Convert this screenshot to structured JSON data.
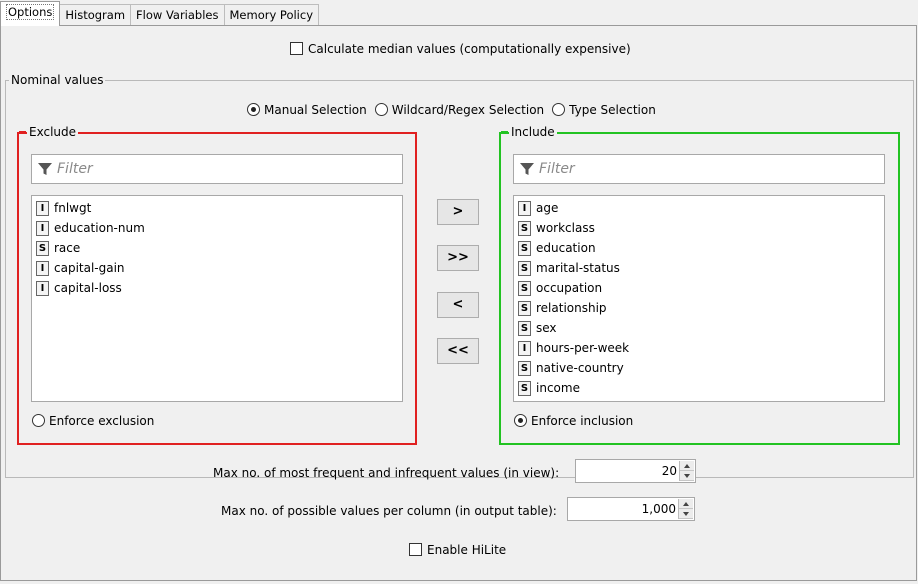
{
  "tabs": [
    "Options",
    "Histogram",
    "Flow Variables",
    "Memory Policy"
  ],
  "median": {
    "label": "Calculate median values (computationally expensive)",
    "checked": false
  },
  "nominal": {
    "legend": "Nominal values",
    "modes": {
      "manual": "Manual Selection",
      "wildcard": "Wildcard/Regex Selection",
      "type": "Type Selection",
      "selected": "Manual Selection"
    },
    "exclude": {
      "legend": "Exclude",
      "border_color": "#e02020",
      "filter_placeholder": "Filter",
      "items": [
        {
          "type": "I",
          "name": "fnlwgt"
        },
        {
          "type": "I",
          "name": "education-num"
        },
        {
          "type": "S",
          "name": "race"
        },
        {
          "type": "I",
          "name": "capital-gain"
        },
        {
          "type": "I",
          "name": "capital-loss"
        }
      ],
      "enforce_label": "Enforce exclusion"
    },
    "include": {
      "legend": "Include",
      "border_color": "#22c322",
      "filter_placeholder": "Filter",
      "items": [
        {
          "type": "I",
          "name": "age"
        },
        {
          "type": "S",
          "name": "workclass"
        },
        {
          "type": "S",
          "name": "education"
        },
        {
          "type": "S",
          "name": "marital-status"
        },
        {
          "type": "S",
          "name": "occupation"
        },
        {
          "type": "S",
          "name": "relationship"
        },
        {
          "type": "S",
          "name": "sex"
        },
        {
          "type": "I",
          "name": "hours-per-week"
        },
        {
          "type": "S",
          "name": "native-country"
        },
        {
          "type": "S",
          "name": "income"
        }
      ],
      "enforce_label": "Enforce inclusion"
    },
    "buttons": {
      "add": ">",
      "add_all": ">>",
      "remove": "<",
      "remove_all": "<<"
    }
  },
  "settings": {
    "max_freq_label": "Max no. of most frequent and infrequent values (in view):",
    "max_freq_value": "20",
    "max_possible_label": "Max no. of possible values per column (in output table):",
    "max_possible_value": "1,000",
    "hilite_label": "Enable HiLite"
  }
}
